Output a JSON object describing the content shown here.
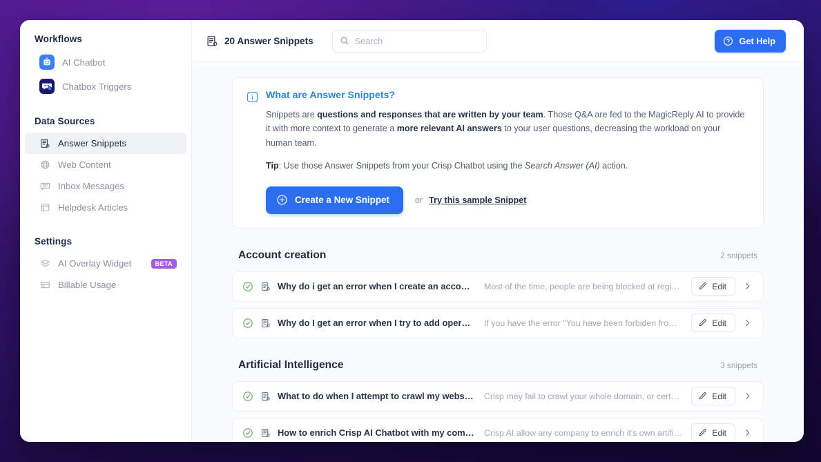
{
  "sidebar": {
    "groups": [
      {
        "title": "Workflows",
        "items": [
          {
            "label": "AI Chatbot",
            "icon": "robot-tile-icon",
            "active": false
          },
          {
            "label": "Chatbox Triggers",
            "icon": "chatbox-tile-icon",
            "active": false
          }
        ]
      },
      {
        "title": "Data Sources",
        "items": [
          {
            "label": "Answer Snippets",
            "icon": "snippet-doc-icon",
            "active": true
          },
          {
            "label": "Web Content",
            "icon": "globe-icon",
            "active": false
          },
          {
            "label": "Inbox Messages",
            "icon": "chat-bubble-icon",
            "active": false
          },
          {
            "label": "Helpdesk Articles",
            "icon": "article-window-icon",
            "active": false
          }
        ]
      },
      {
        "title": "Settings",
        "items": [
          {
            "label": "AI Overlay Widget",
            "icon": "layers-icon",
            "active": false,
            "badge": "BETA"
          },
          {
            "label": "Billable Usage",
            "icon": "credit-card-icon",
            "active": false
          }
        ]
      }
    ]
  },
  "header": {
    "title": "20 Answer Snippets",
    "title_icon": "snippet-doc-icon",
    "search": {
      "placeholder": "Search",
      "value": "",
      "icon": "search-icon"
    },
    "get_help_label": "Get Help",
    "get_help_icon": "question-circle-icon"
  },
  "banner": {
    "icon": "info-icon",
    "title": "What are Answer Snippets?",
    "paragraph": {
      "part1": "Snippets are ",
      "bold1": "questions and responses that are written by your team",
      "part2": ". Those Q&A are fed to the MagicReply AI to provide it with more context to generate a ",
      "bold2": "more relevant AI answers",
      "part3": " to your user questions, decreasing the workload on your human team."
    },
    "tip": {
      "label": "Tip",
      "part1": ": Use those Answer Snippets from your Crisp Chatbot using the ",
      "italic": "Search Answer (AI)",
      "part2": " action."
    },
    "create_button": "Create a New Snippet",
    "create_icon": "plus-circle-icon",
    "or_text": "or",
    "sample_link": "Try this sample Snippet"
  },
  "groups": [
    {
      "title": "Account creation",
      "count": "2 snippets",
      "rows": [
        {
          "status_icon": "check-circle-icon",
          "doc_icon": "snippet-doc-icon",
          "question": "Why do i get an error when I create an accoun...",
          "answer": "Most of the time, people are being blocked at registrat...",
          "edit_label": "Edit",
          "edit_icon": "pencil-icon",
          "chevron_icon": "chevron-right-icon"
        },
        {
          "status_icon": "check-circle-icon",
          "doc_icon": "snippet-doc-icon",
          "question": "Why do I get an error when I try to add operat...",
          "answer": "If you have the error \"You have been forbiden from cre...",
          "edit_label": "Edit",
          "edit_icon": "pencil-icon",
          "chevron_icon": "chevron-right-icon"
        }
      ]
    },
    {
      "title": "Artificial Intelligence",
      "count": "3 snippets",
      "rows": [
        {
          "status_icon": "check-circle-icon",
          "doc_icon": "snippet-doc-icon",
          "question": "What to do when I attempt to crawl my websit...",
          "answer": "Crisp may fail to crawl your whole domain, or certain p...",
          "edit_label": "Edit",
          "edit_icon": "pencil-icon",
          "chevron_icon": "chevron-right-icon"
        },
        {
          "status_icon": "check-circle-icon",
          "doc_icon": "snippet-doc-icon",
          "question": "How to enrich Crisp AI Chatbot with my comp...",
          "answer": "Crisp AI allow any company to enrich it's own artificial i...",
          "edit_label": "Edit",
          "edit_icon": "pencil-icon",
          "chevron_icon": "chevron-right-icon"
        }
      ]
    }
  ],
  "colors": {
    "accent_blue": "#2b6ef0",
    "info_blue": "#2e86d4",
    "beta_purple": "#a55ee0",
    "check_green": "#5faa62",
    "text_dark": "#1f2b43",
    "text_muted": "#8a90a0"
  }
}
